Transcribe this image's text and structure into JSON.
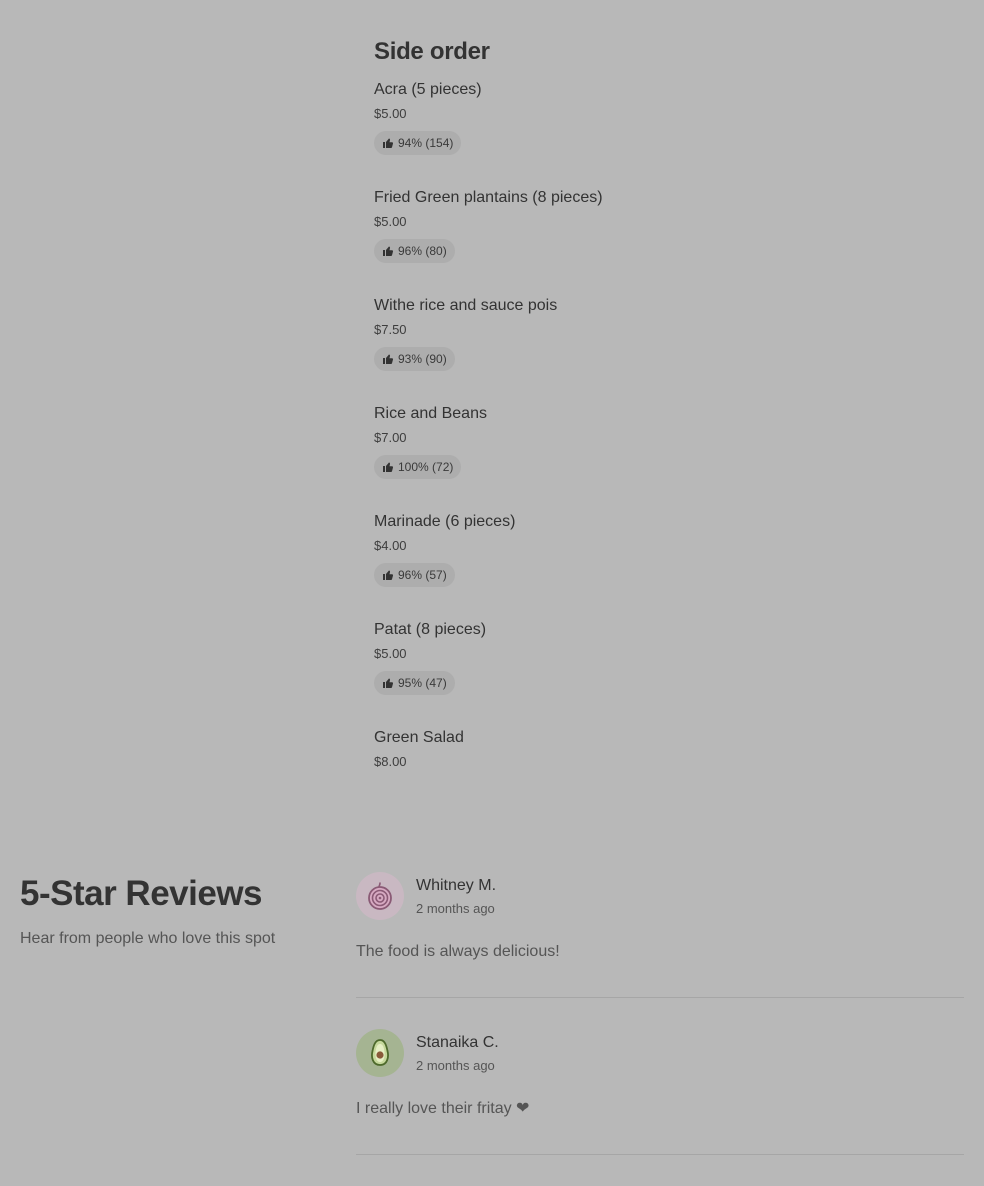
{
  "side_order": {
    "title": "Side order",
    "items": [
      {
        "name": "Acra (5 pieces)",
        "price": "$5.00",
        "rating": "94% (154)"
      },
      {
        "name": "Fried Green plantains (8 pieces)",
        "price": "$5.00",
        "rating": "96% (80)"
      },
      {
        "name": "Withe rice and sauce pois",
        "price": "$7.50",
        "rating": "93% (90)"
      },
      {
        "name": "Rice and Beans",
        "price": "$7.00",
        "rating": "100% (72)"
      },
      {
        "name": "Marinade (6 pieces)",
        "price": "$4.00",
        "rating": "96% (57)"
      },
      {
        "name": "Patat (8 pieces)",
        "price": "$5.00",
        "rating": "95% (47)"
      },
      {
        "name": "Green Salad",
        "price": "$8.00"
      }
    ],
    "rating_icon": "thumbs-up-icon"
  },
  "reviews": {
    "title": "5-Star Reviews",
    "subtitle": "Hear from people who love this spot",
    "items": [
      {
        "name": "Whitney M.",
        "time": "2 months ago",
        "text": "The food is always delicious!",
        "avatar_icon": "onion-icon"
      },
      {
        "name": "Stanaika C.",
        "time": "2 months ago",
        "text": "I really love their fritay ❤",
        "avatar_icon": "avocado-icon"
      }
    ]
  }
}
